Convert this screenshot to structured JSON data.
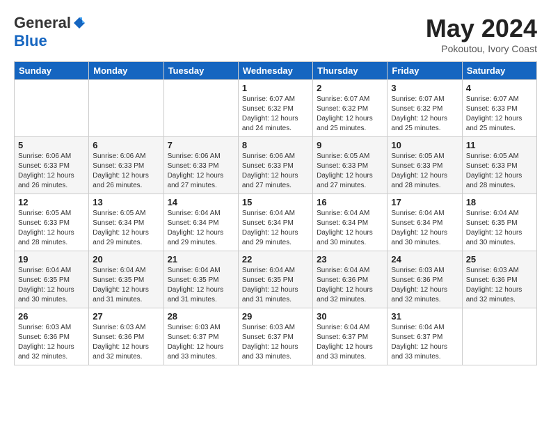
{
  "header": {
    "logo_general": "General",
    "logo_blue": "Blue",
    "month_title": "May 2024",
    "location": "Pokoutou, Ivory Coast"
  },
  "days_of_week": [
    "Sunday",
    "Monday",
    "Tuesday",
    "Wednesday",
    "Thursday",
    "Friday",
    "Saturday"
  ],
  "weeks": [
    [
      {
        "day": "",
        "info": ""
      },
      {
        "day": "",
        "info": ""
      },
      {
        "day": "",
        "info": ""
      },
      {
        "day": "1",
        "info": "Sunrise: 6:07 AM\nSunset: 6:32 PM\nDaylight: 12 hours\nand 24 minutes."
      },
      {
        "day": "2",
        "info": "Sunrise: 6:07 AM\nSunset: 6:32 PM\nDaylight: 12 hours\nand 25 minutes."
      },
      {
        "day": "3",
        "info": "Sunrise: 6:07 AM\nSunset: 6:32 PM\nDaylight: 12 hours\nand 25 minutes."
      },
      {
        "day": "4",
        "info": "Sunrise: 6:07 AM\nSunset: 6:33 PM\nDaylight: 12 hours\nand 25 minutes."
      }
    ],
    [
      {
        "day": "5",
        "info": "Sunrise: 6:06 AM\nSunset: 6:33 PM\nDaylight: 12 hours\nand 26 minutes."
      },
      {
        "day": "6",
        "info": "Sunrise: 6:06 AM\nSunset: 6:33 PM\nDaylight: 12 hours\nand 26 minutes."
      },
      {
        "day": "7",
        "info": "Sunrise: 6:06 AM\nSunset: 6:33 PM\nDaylight: 12 hours\nand 27 minutes."
      },
      {
        "day": "8",
        "info": "Sunrise: 6:06 AM\nSunset: 6:33 PM\nDaylight: 12 hours\nand 27 minutes."
      },
      {
        "day": "9",
        "info": "Sunrise: 6:05 AM\nSunset: 6:33 PM\nDaylight: 12 hours\nand 27 minutes."
      },
      {
        "day": "10",
        "info": "Sunrise: 6:05 AM\nSunset: 6:33 PM\nDaylight: 12 hours\nand 28 minutes."
      },
      {
        "day": "11",
        "info": "Sunrise: 6:05 AM\nSunset: 6:33 PM\nDaylight: 12 hours\nand 28 minutes."
      }
    ],
    [
      {
        "day": "12",
        "info": "Sunrise: 6:05 AM\nSunset: 6:33 PM\nDaylight: 12 hours\nand 28 minutes."
      },
      {
        "day": "13",
        "info": "Sunrise: 6:05 AM\nSunset: 6:34 PM\nDaylight: 12 hours\nand 29 minutes."
      },
      {
        "day": "14",
        "info": "Sunrise: 6:04 AM\nSunset: 6:34 PM\nDaylight: 12 hours\nand 29 minutes."
      },
      {
        "day": "15",
        "info": "Sunrise: 6:04 AM\nSunset: 6:34 PM\nDaylight: 12 hours\nand 29 minutes."
      },
      {
        "day": "16",
        "info": "Sunrise: 6:04 AM\nSunset: 6:34 PM\nDaylight: 12 hours\nand 30 minutes."
      },
      {
        "day": "17",
        "info": "Sunrise: 6:04 AM\nSunset: 6:34 PM\nDaylight: 12 hours\nand 30 minutes."
      },
      {
        "day": "18",
        "info": "Sunrise: 6:04 AM\nSunset: 6:35 PM\nDaylight: 12 hours\nand 30 minutes."
      }
    ],
    [
      {
        "day": "19",
        "info": "Sunrise: 6:04 AM\nSunset: 6:35 PM\nDaylight: 12 hours\nand 30 minutes."
      },
      {
        "day": "20",
        "info": "Sunrise: 6:04 AM\nSunset: 6:35 PM\nDaylight: 12 hours\nand 31 minutes."
      },
      {
        "day": "21",
        "info": "Sunrise: 6:04 AM\nSunset: 6:35 PM\nDaylight: 12 hours\nand 31 minutes."
      },
      {
        "day": "22",
        "info": "Sunrise: 6:04 AM\nSunset: 6:35 PM\nDaylight: 12 hours\nand 31 minutes."
      },
      {
        "day": "23",
        "info": "Sunrise: 6:04 AM\nSunset: 6:36 PM\nDaylight: 12 hours\nand 32 minutes."
      },
      {
        "day": "24",
        "info": "Sunrise: 6:03 AM\nSunset: 6:36 PM\nDaylight: 12 hours\nand 32 minutes."
      },
      {
        "day": "25",
        "info": "Sunrise: 6:03 AM\nSunset: 6:36 PM\nDaylight: 12 hours\nand 32 minutes."
      }
    ],
    [
      {
        "day": "26",
        "info": "Sunrise: 6:03 AM\nSunset: 6:36 PM\nDaylight: 12 hours\nand 32 minutes."
      },
      {
        "day": "27",
        "info": "Sunrise: 6:03 AM\nSunset: 6:36 PM\nDaylight: 12 hours\nand 32 minutes."
      },
      {
        "day": "28",
        "info": "Sunrise: 6:03 AM\nSunset: 6:37 PM\nDaylight: 12 hours\nand 33 minutes."
      },
      {
        "day": "29",
        "info": "Sunrise: 6:03 AM\nSunset: 6:37 PM\nDaylight: 12 hours\nand 33 minutes."
      },
      {
        "day": "30",
        "info": "Sunrise: 6:04 AM\nSunset: 6:37 PM\nDaylight: 12 hours\nand 33 minutes."
      },
      {
        "day": "31",
        "info": "Sunrise: 6:04 AM\nSunset: 6:37 PM\nDaylight: 12 hours\nand 33 minutes."
      },
      {
        "day": "",
        "info": ""
      }
    ]
  ]
}
